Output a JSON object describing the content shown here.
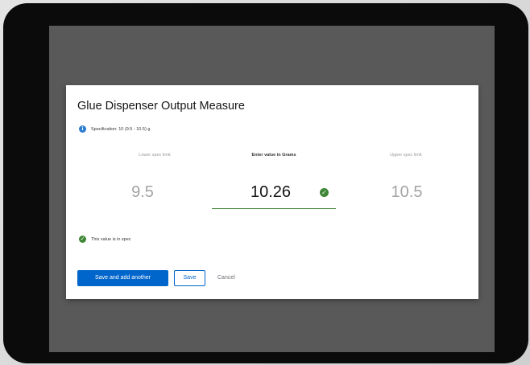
{
  "dialog": {
    "title": "Glue Dispenser Output Measure",
    "specification": "Specification: 10 (9.5 - 10.5) g",
    "lower_label": "Lower spec limit",
    "center_label": "Enter value in Grams",
    "upper_label": "Upper spec limit",
    "lower_value": "9.5",
    "value": "10.26",
    "upper_value": "10.5",
    "status": "This value is in spec",
    "save_add_label": "Save and add another",
    "save_label": "Save",
    "cancel_label": "Cancel"
  },
  "icons": {
    "info": "info-circle-icon",
    "check": "check-circle-icon"
  },
  "colors": {
    "primary": "#0066cc",
    "success": "#3e8635",
    "info": "#2b7bd1",
    "overlay": "#595959"
  }
}
